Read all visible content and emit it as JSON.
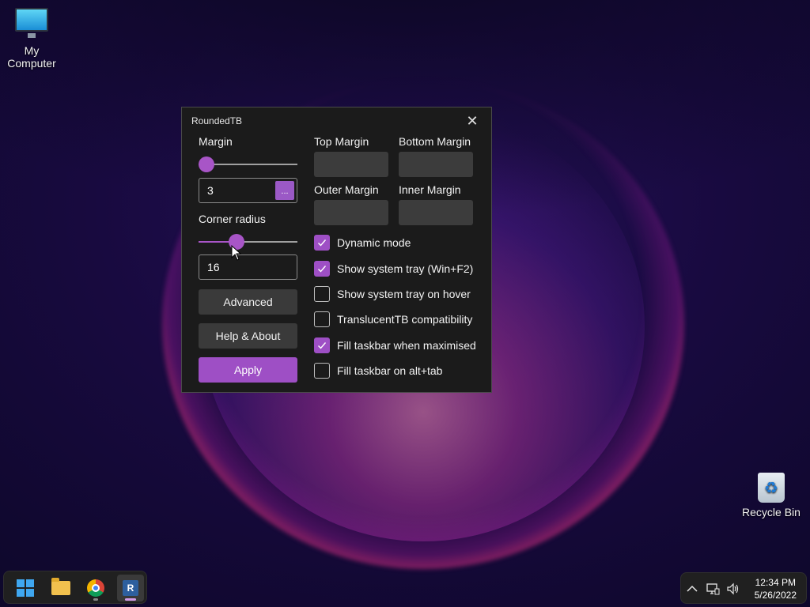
{
  "desktop": {
    "icons": [
      {
        "label": "My Computer"
      },
      {
        "label": "Recycle Bin"
      }
    ]
  },
  "window": {
    "title": "RoundedTB",
    "close_symbol": "✕",
    "margin": {
      "label": "Margin",
      "slider_fraction": 0.0,
      "value": "3",
      "more_button": "..."
    },
    "corner_radius": {
      "label": "Corner radius",
      "slider_fraction": 0.36,
      "value": "16"
    },
    "buttons": {
      "advanced": "Advanced",
      "help_about": "Help & About",
      "apply": "Apply"
    },
    "fields": {
      "top_margin": "Top Margin",
      "bottom_margin": "Bottom Margin",
      "outer_margin": "Outer Margin",
      "inner_margin": "Inner Margin"
    },
    "options": [
      {
        "label": "Dynamic mode",
        "checked": true
      },
      {
        "label": "Show system tray (Win+F2)",
        "checked": true
      },
      {
        "label": "Show system tray on hover",
        "checked": false
      },
      {
        "label": "TranslucentTB compatibility",
        "checked": false
      },
      {
        "label": "Fill taskbar when maximised",
        "checked": true
      },
      {
        "label": "Fill taskbar on alt+tab",
        "checked": false
      }
    ],
    "accent_color": "#9e4fc5"
  },
  "taskbar": {
    "apps": [
      {
        "icon": "windows-start-icon"
      },
      {
        "icon": "file-explorer-icon"
      },
      {
        "icon": "chrome-icon"
      },
      {
        "icon": "roundedtb-app-icon",
        "letter": "R"
      }
    ],
    "tray": {
      "time": "12:34 PM",
      "date": "5/26/2022"
    }
  }
}
